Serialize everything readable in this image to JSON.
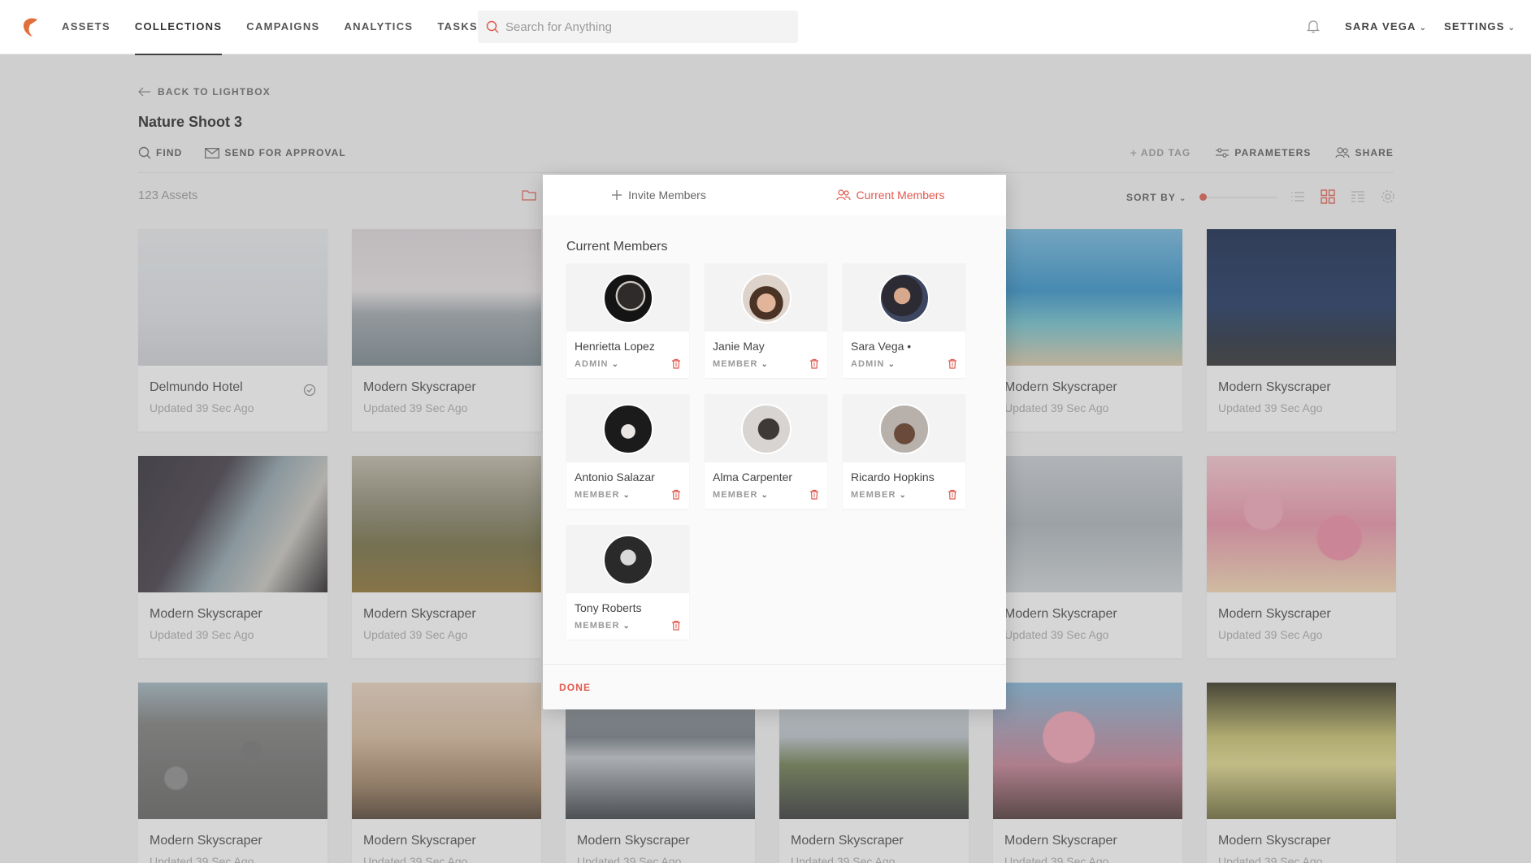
{
  "nav": {
    "items": [
      {
        "label": "ASSETS",
        "active": false
      },
      {
        "label": "COLLECTIONS",
        "active": true
      },
      {
        "label": "CAMPAIGNS",
        "active": false
      },
      {
        "label": "ANALYTICS",
        "active": false
      },
      {
        "label": "TASKS",
        "active": false
      }
    ],
    "search_placeholder": "Search for Anything",
    "user": "SARA VEGA",
    "settings": "SETTINGS"
  },
  "page": {
    "back_label": "BACK TO LIGHTBOX",
    "title": "Nature Shoot 3",
    "find_label": "FIND",
    "send_label": "SEND FOR APPROVAL",
    "add_tag_label": "ADD TAG",
    "parameters_label": "PARAMETERS",
    "share_label": "SHARE",
    "asset_count": "123 Assets",
    "sort_label": "SORT BY"
  },
  "assets": [
    {
      "title": "Delmundo Hotel",
      "subtitle": "Updated 39 Sec Ago",
      "thumb": "t1",
      "checked": true
    },
    {
      "title": "Modern Skyscraper",
      "subtitle": "Updated 39 Sec Ago",
      "thumb": "t2",
      "checked": false
    },
    {
      "title": "Modern Skyscraper",
      "subtitle": "Updated 39 Sec Ago",
      "thumb": "t2",
      "checked": false
    },
    {
      "title": "Modern Skyscraper",
      "subtitle": "Updated 39 Sec Ago",
      "thumb": "t2",
      "checked": false
    },
    {
      "title": "Modern Skyscraper",
      "subtitle": "Updated 39 Sec Ago",
      "thumb": "t3",
      "checked": false
    },
    {
      "title": "Modern Skyscraper",
      "subtitle": "Updated 39 Sec Ago",
      "thumb": "t4",
      "checked": false
    },
    {
      "title": "Modern Skyscraper",
      "subtitle": "Updated 39 Sec Ago",
      "thumb": "t5",
      "checked": false
    },
    {
      "title": "Modern Skyscraper",
      "subtitle": "Updated 39 Sec Ago",
      "thumb": "t6",
      "checked": false
    },
    {
      "title": "Modern Skyscraper",
      "subtitle": "Updated 39 Sec Ago",
      "thumb": "t6",
      "checked": false
    },
    {
      "title": "Modern Skyscraper",
      "subtitle": "Updated 39 Sec Ago",
      "thumb": "t6",
      "checked": false
    },
    {
      "title": "Modern Skyscraper",
      "subtitle": "Updated 39 Sec Ago",
      "thumb": "t7",
      "checked": false
    },
    {
      "title": "Modern Skyscraper",
      "subtitle": "Updated 39 Sec Ago",
      "thumb": "t8",
      "checked": false
    },
    {
      "title": "Modern Skyscraper",
      "subtitle": "Updated 39 Sec Ago",
      "thumb": "t9",
      "checked": false
    },
    {
      "title": "Modern Skyscraper",
      "subtitle": "Updated 39 Sec Ago",
      "thumb": "t10",
      "checked": false
    },
    {
      "title": "Modern Skyscraper",
      "subtitle": "Updated 39 Sec Ago",
      "thumb": "t11",
      "checked": false
    },
    {
      "title": "Modern Skyscraper",
      "subtitle": "Updated 39 Sec Ago",
      "thumb": "t12",
      "checked": false
    },
    {
      "title": "Modern Skyscraper",
      "subtitle": "Updated 39 Sec Ago",
      "thumb": "t13",
      "checked": false
    },
    {
      "title": "Modern Skyscraper",
      "subtitle": "Updated 39 Sec Ago",
      "thumb": "t14",
      "checked": false
    }
  ],
  "modal": {
    "tab_invite": "Invite Members",
    "tab_current": "Current Members",
    "heading": "Current Members",
    "done_label": "DONE",
    "members": [
      {
        "name": "Henrietta Lopez",
        "role": "ADMIN",
        "avatar": "av1"
      },
      {
        "name": "Janie May",
        "role": "MEMBER",
        "avatar": "av2"
      },
      {
        "name": "Sara Vega •",
        "role": "ADMIN",
        "avatar": "av3"
      },
      {
        "name": "Antonio Salazar",
        "role": "MEMBER",
        "avatar": "av4"
      },
      {
        "name": "Alma Carpenter",
        "role": "MEMBER",
        "avatar": "av5"
      },
      {
        "name": "Ricardo Hopkins",
        "role": "MEMBER",
        "avatar": "av6"
      },
      {
        "name": "Tony Roberts",
        "role": "MEMBER",
        "avatar": "av7"
      }
    ]
  },
  "colors": {
    "accent": "#e05a4f"
  }
}
